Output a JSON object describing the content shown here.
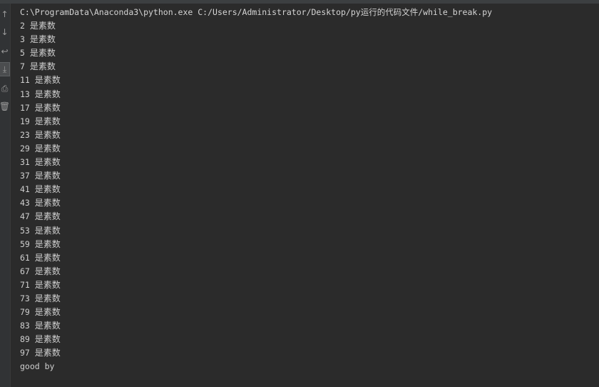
{
  "toolbar": {
    "icons": [
      {
        "name": "up-arrow-icon",
        "glyph": "↑"
      },
      {
        "name": "down-arrow-icon",
        "glyph": "↓"
      },
      {
        "name": "soft-wrap-icon",
        "glyph": "↩"
      },
      {
        "name": "scroll-to-end-icon",
        "glyph": "⤓"
      },
      {
        "name": "print-icon",
        "glyph": "⎙"
      },
      {
        "name": "trash-icon",
        "glyph": "🗑"
      }
    ]
  },
  "console": {
    "command": "C:\\ProgramData\\Anaconda3\\python.exe C:/Users/Administrator/Desktop/py运行的代码文件/while_break.py",
    "primes": [
      {
        "num": "2",
        "text": "是素数"
      },
      {
        "num": "3",
        "text": "是素数"
      },
      {
        "num": "5",
        "text": "是素数"
      },
      {
        "num": "7",
        "text": "是素数"
      },
      {
        "num": "11",
        "text": "是素数"
      },
      {
        "num": "13",
        "text": "是素数"
      },
      {
        "num": "17",
        "text": "是素数"
      },
      {
        "num": "19",
        "text": "是素数"
      },
      {
        "num": "23",
        "text": "是素数"
      },
      {
        "num": "29",
        "text": "是素数"
      },
      {
        "num": "31",
        "text": "是素数"
      },
      {
        "num": "37",
        "text": "是素数"
      },
      {
        "num": "41",
        "text": "是素数"
      },
      {
        "num": "43",
        "text": "是素数"
      },
      {
        "num": "47",
        "text": "是素数"
      },
      {
        "num": "53",
        "text": "是素数"
      },
      {
        "num": "59",
        "text": "是素数"
      },
      {
        "num": "61",
        "text": "是素数"
      },
      {
        "num": "67",
        "text": "是素数"
      },
      {
        "num": "71",
        "text": "是素数"
      },
      {
        "num": "73",
        "text": "是素数"
      },
      {
        "num": "79",
        "text": "是素数"
      },
      {
        "num": "83",
        "text": "是素数"
      },
      {
        "num": "89",
        "text": "是素数"
      },
      {
        "num": "97",
        "text": "是素数"
      }
    ],
    "footer": "good by"
  }
}
